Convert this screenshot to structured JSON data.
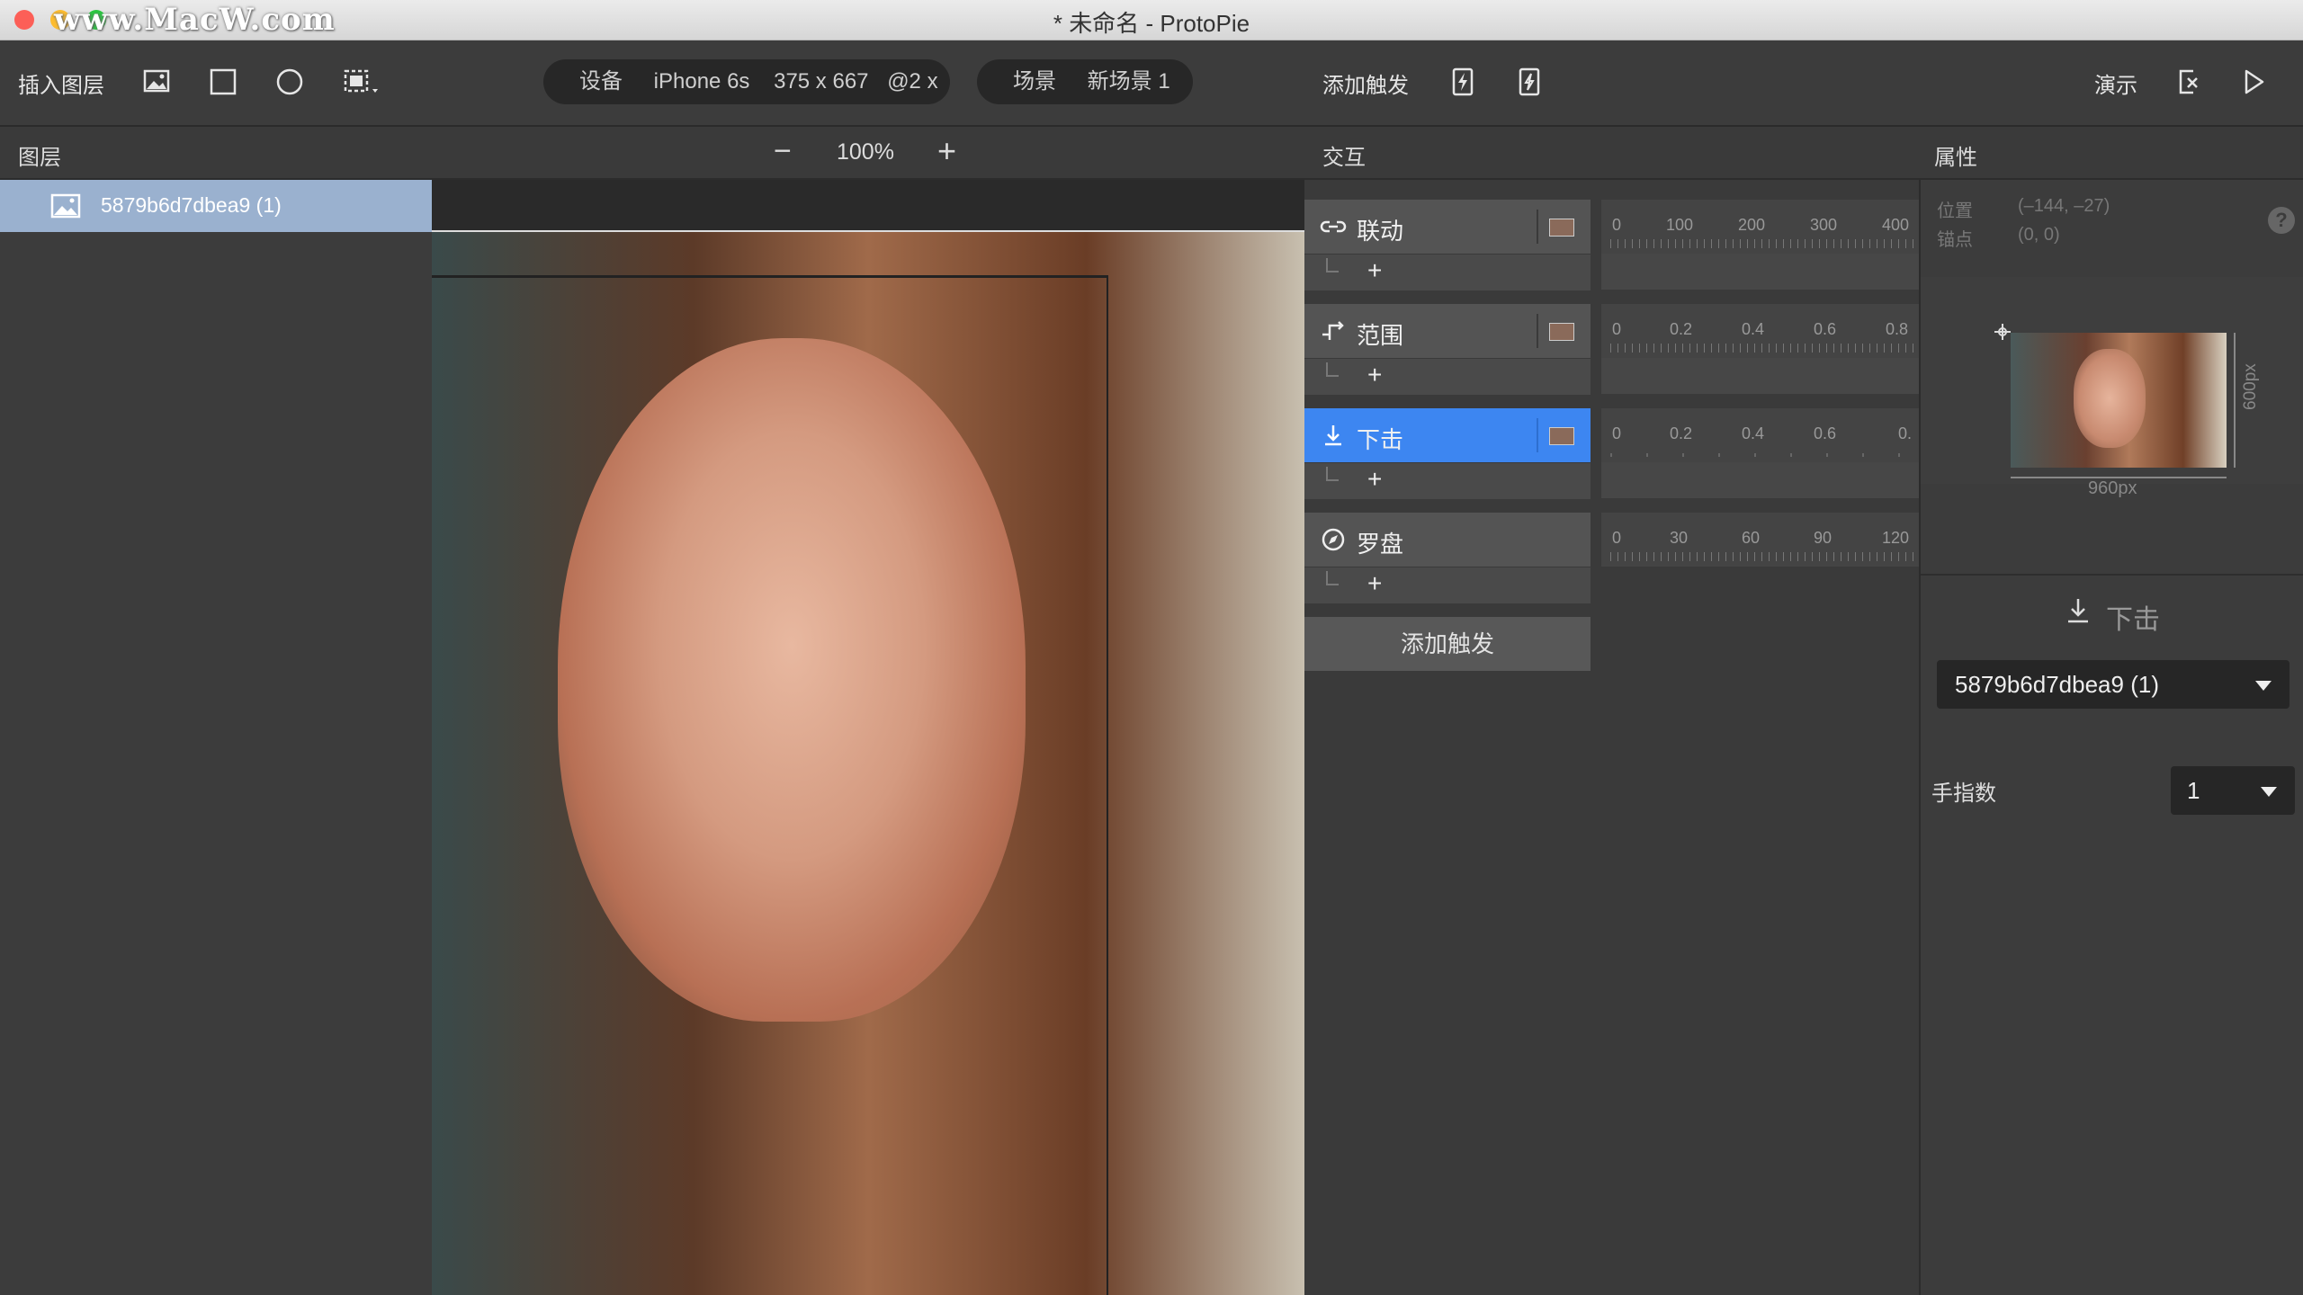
{
  "window": {
    "title": "* 未命名 - ProtoPie",
    "watermark": "www.MacW.com"
  },
  "toolbar": {
    "insert_layer": "插入图层",
    "device_label": "设备",
    "device_name": "iPhone 6s",
    "device_size": "375 x 667",
    "device_scale": "@2 x",
    "scene_label": "场景",
    "scene_name": "新场景 1",
    "add_trigger": "添加触发",
    "preview": "演示"
  },
  "headers": {
    "layers": "图层",
    "zoom": "100%",
    "interactions": "交互",
    "properties": "属性"
  },
  "layers": [
    {
      "name": "5879b6d7dbea9 (1)",
      "selected": true
    }
  ],
  "triggers": [
    {
      "label": "联动",
      "icon": "link-icon",
      "selected": false,
      "ticks": [
        "0",
        "100",
        "200",
        "300",
        "400"
      ]
    },
    {
      "label": "范围",
      "icon": "range-icon",
      "selected": false,
      "ticks": [
        "0",
        "0.2",
        "0.4",
        "0.6",
        "0.8"
      ]
    },
    {
      "label": "下击",
      "icon": "tap-down-icon",
      "selected": true,
      "ticks": [
        "0",
        "0.2",
        "0.4",
        "0.6",
        "0."
      ]
    },
    {
      "label": "罗盘",
      "icon": "compass-icon",
      "selected": false,
      "ticks": [
        "0",
        "30",
        "60",
        "90",
        "120"
      ]
    }
  ],
  "add_trigger_button": "添加触发",
  "plus_label": "+",
  "properties": {
    "position_label": "位置",
    "position_value": "(–144, –27)",
    "anchor_label": "锚点",
    "anchor_value": "(0, 0)",
    "help": "?",
    "width_label": "960px",
    "height_label": "600px",
    "trigger_title": "下击",
    "target_layer": "5879b6d7dbea9 (1)",
    "fingers_label": "手指数",
    "fingers_value": "1"
  },
  "colors": {
    "selected_trigger": "#3d86f1",
    "selected_layer": "#9ab1cf"
  }
}
